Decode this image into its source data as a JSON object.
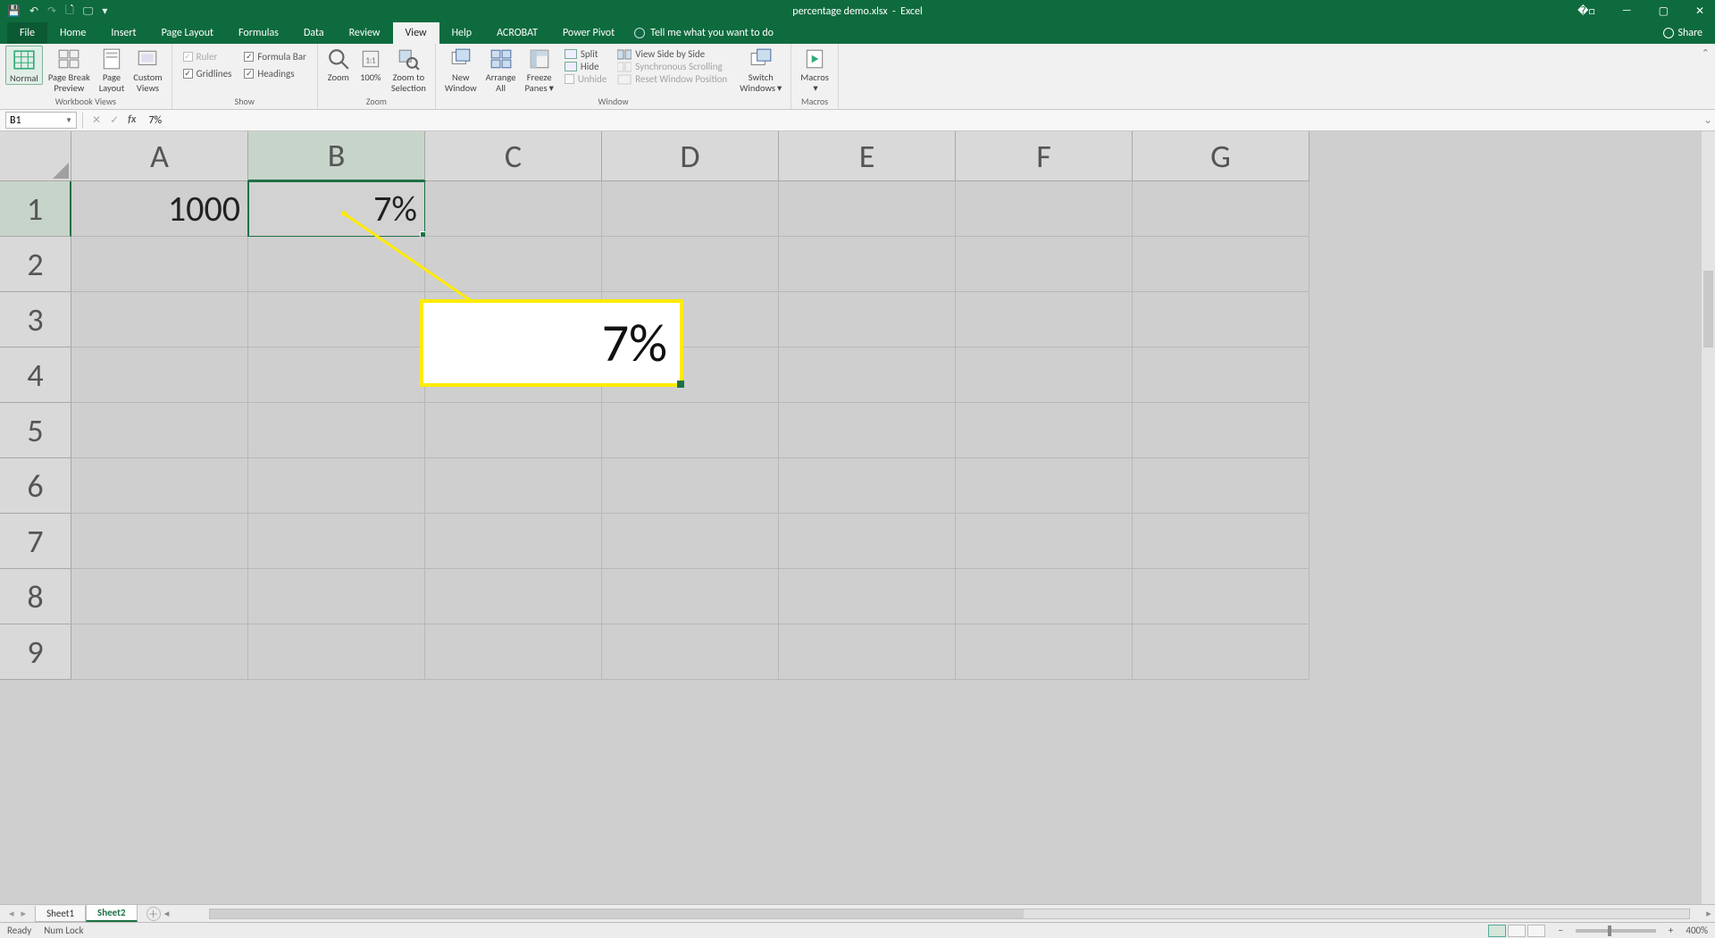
{
  "title": {
    "filename": "percentage demo.xlsx",
    "app": "Excel"
  },
  "qat": {
    "save": "💾",
    "undo": "↶",
    "redo": "↷",
    "new": "🗋",
    "touch": "🖵",
    "more": "▾"
  },
  "winctrl": {
    "ribbon_opts": "�□",
    "min": "—",
    "max": "▢",
    "close": "✕"
  },
  "tabs": {
    "file": "File",
    "home": "Home",
    "insert": "Insert",
    "pagelayout": "Page Layout",
    "formulas": "Formulas",
    "data": "Data",
    "review": "Review",
    "view": "View",
    "help": "Help",
    "acrobat": "ACROBAT",
    "powerpivot": "Power Pivot",
    "tell": "Tell me what you want to do",
    "share": "Share"
  },
  "ribbon": {
    "workbook_views": {
      "normal": "Normal",
      "page_break": "Page Break\nPreview",
      "page_layout": "Page\nLayout",
      "custom_views": "Custom\nViews",
      "group": "Workbook Views"
    },
    "show": {
      "ruler": "Ruler",
      "formula_bar": "Formula Bar",
      "gridlines": "Gridlines",
      "headings": "Headings",
      "group": "Show"
    },
    "zoom": {
      "zoom": "Zoom",
      "p100": "100%",
      "to_sel": "Zoom to\nSelection",
      "group": "Zoom"
    },
    "window": {
      "new_window": "New\nWindow",
      "arrange_all": "Arrange\nAll",
      "freeze_panes": "Freeze\nPanes",
      "split": "Split",
      "hide": "Hide",
      "unhide": "Unhide",
      "side_by_side": "View Side by Side",
      "sync_scroll": "Synchronous Scrolling",
      "reset_pos": "Reset Window Position",
      "switch_windows": "Switch\nWindows",
      "group": "Window"
    },
    "macros": {
      "macros": "Macros",
      "group": "Macros"
    }
  },
  "formula_bar": {
    "cell_ref": "B1",
    "value": "7%",
    "fx": "fx"
  },
  "grid": {
    "cols": [
      "A",
      "B",
      "C",
      "D",
      "E",
      "F",
      "G"
    ],
    "rows": [
      "1",
      "2",
      "3",
      "4",
      "5",
      "6",
      "7",
      "8",
      "9"
    ],
    "A1": "1000",
    "B1": "7%",
    "selected": "B1"
  },
  "callout": {
    "text": "7%"
  },
  "sheets": {
    "s1": "Sheet1",
    "s2": "Sheet2"
  },
  "status": {
    "ready": "Ready",
    "numlock": "Num Lock",
    "zoom": "400%"
  }
}
